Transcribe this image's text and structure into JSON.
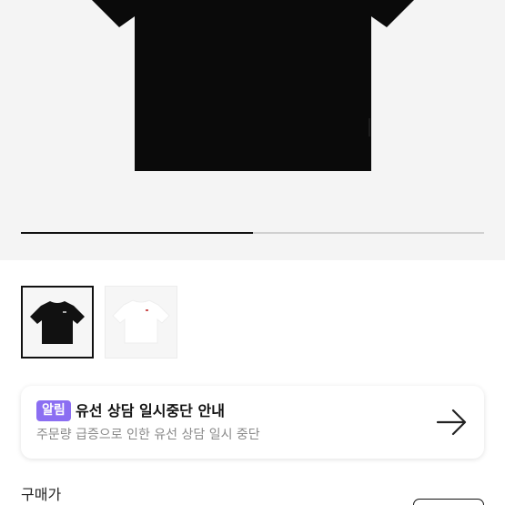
{
  "gallery": {
    "image_index": 1,
    "image_count": 2,
    "progress_fraction": 0.5,
    "thumbnails": [
      {
        "name": "black-tshirt-thumbnail",
        "color": "#111111",
        "selected": true
      },
      {
        "name": "white-tshirt-thumbnail",
        "color": "#ffffff",
        "selected": false
      }
    ]
  },
  "notice": {
    "badge": "알림",
    "title": "유선 상담 일시중단 안내",
    "subtitle": "주문량 급증으로 인한 유선 상담 일시 중단",
    "icon": "arrow-right-icon",
    "badge_color": "#8b6ef2"
  },
  "purchase": {
    "price_label": "구매가"
  }
}
